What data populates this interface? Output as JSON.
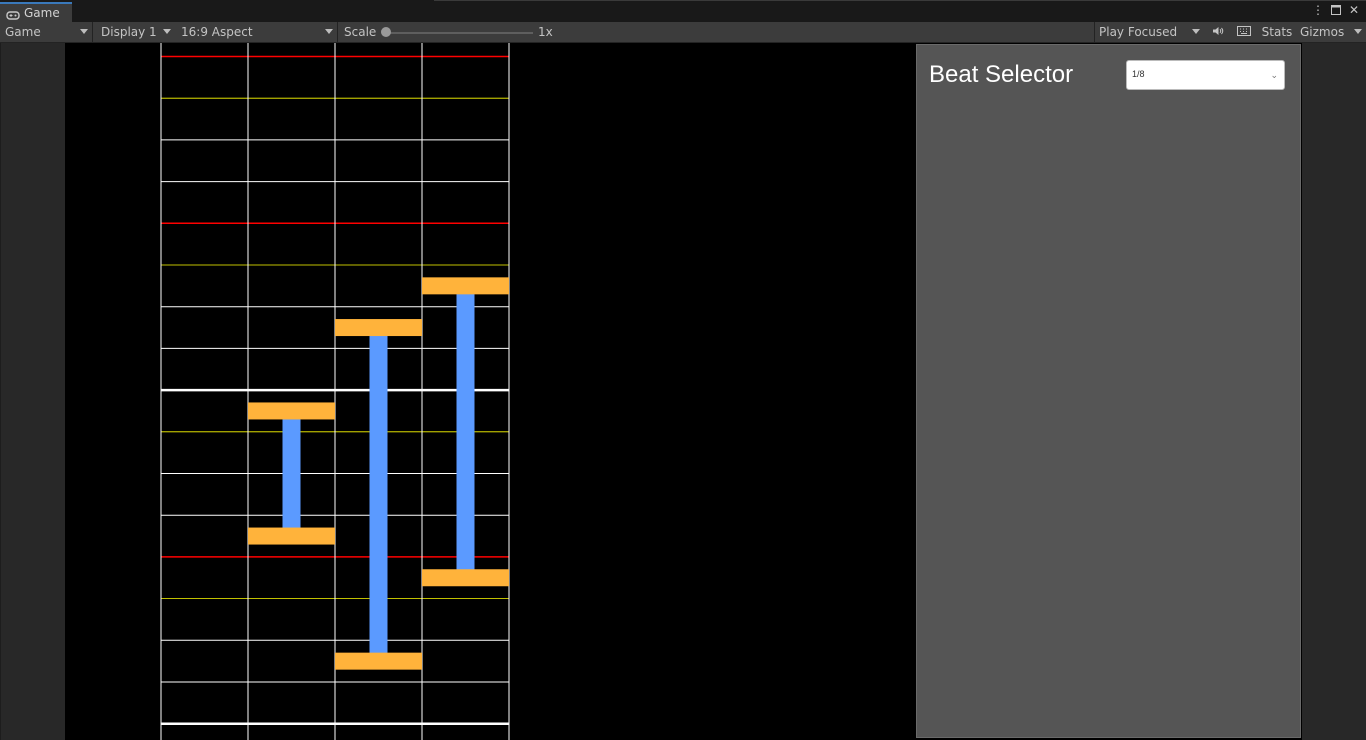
{
  "window": {
    "tab_label": "Game",
    "tab_icon": "gamepad-icon",
    "controls": [
      "more-vertical-icon",
      "maximize-icon",
      "close-icon"
    ]
  },
  "toolbar": {
    "view_mode": "Game",
    "display": "Display 1",
    "aspect": "16:9 Aspect",
    "scale_label": "Scale",
    "scale_value": "1x",
    "scale_level": 0,
    "play_mode": "Play Focused",
    "mute_icon": "speaker-icon",
    "stats_icon": "keyboard-icon",
    "stats_label": "Stats",
    "gizmos_label": "Gizmos"
  },
  "panel": {
    "title": "Beat Selector",
    "dropdown_value": "1/8"
  },
  "chart_grid": {
    "lanes": 4,
    "colors": {
      "background": "#000000",
      "lane_line": "#ffffff",
      "measure_line": "#ff0000",
      "half_line": "#ffff00",
      "beat_line": "#ffffff",
      "note_head": "#ffb33b",
      "hold_body": "#5b9aff"
    },
    "notes": [
      {
        "lane": 1,
        "head_row": 8.5,
        "tail_row": 11.5
      },
      {
        "lane": 2,
        "head_row": 6.5,
        "tail_row": 14.5
      },
      {
        "lane": 3,
        "head_row": 5.5,
        "tail_row": 12.5
      }
    ]
  }
}
